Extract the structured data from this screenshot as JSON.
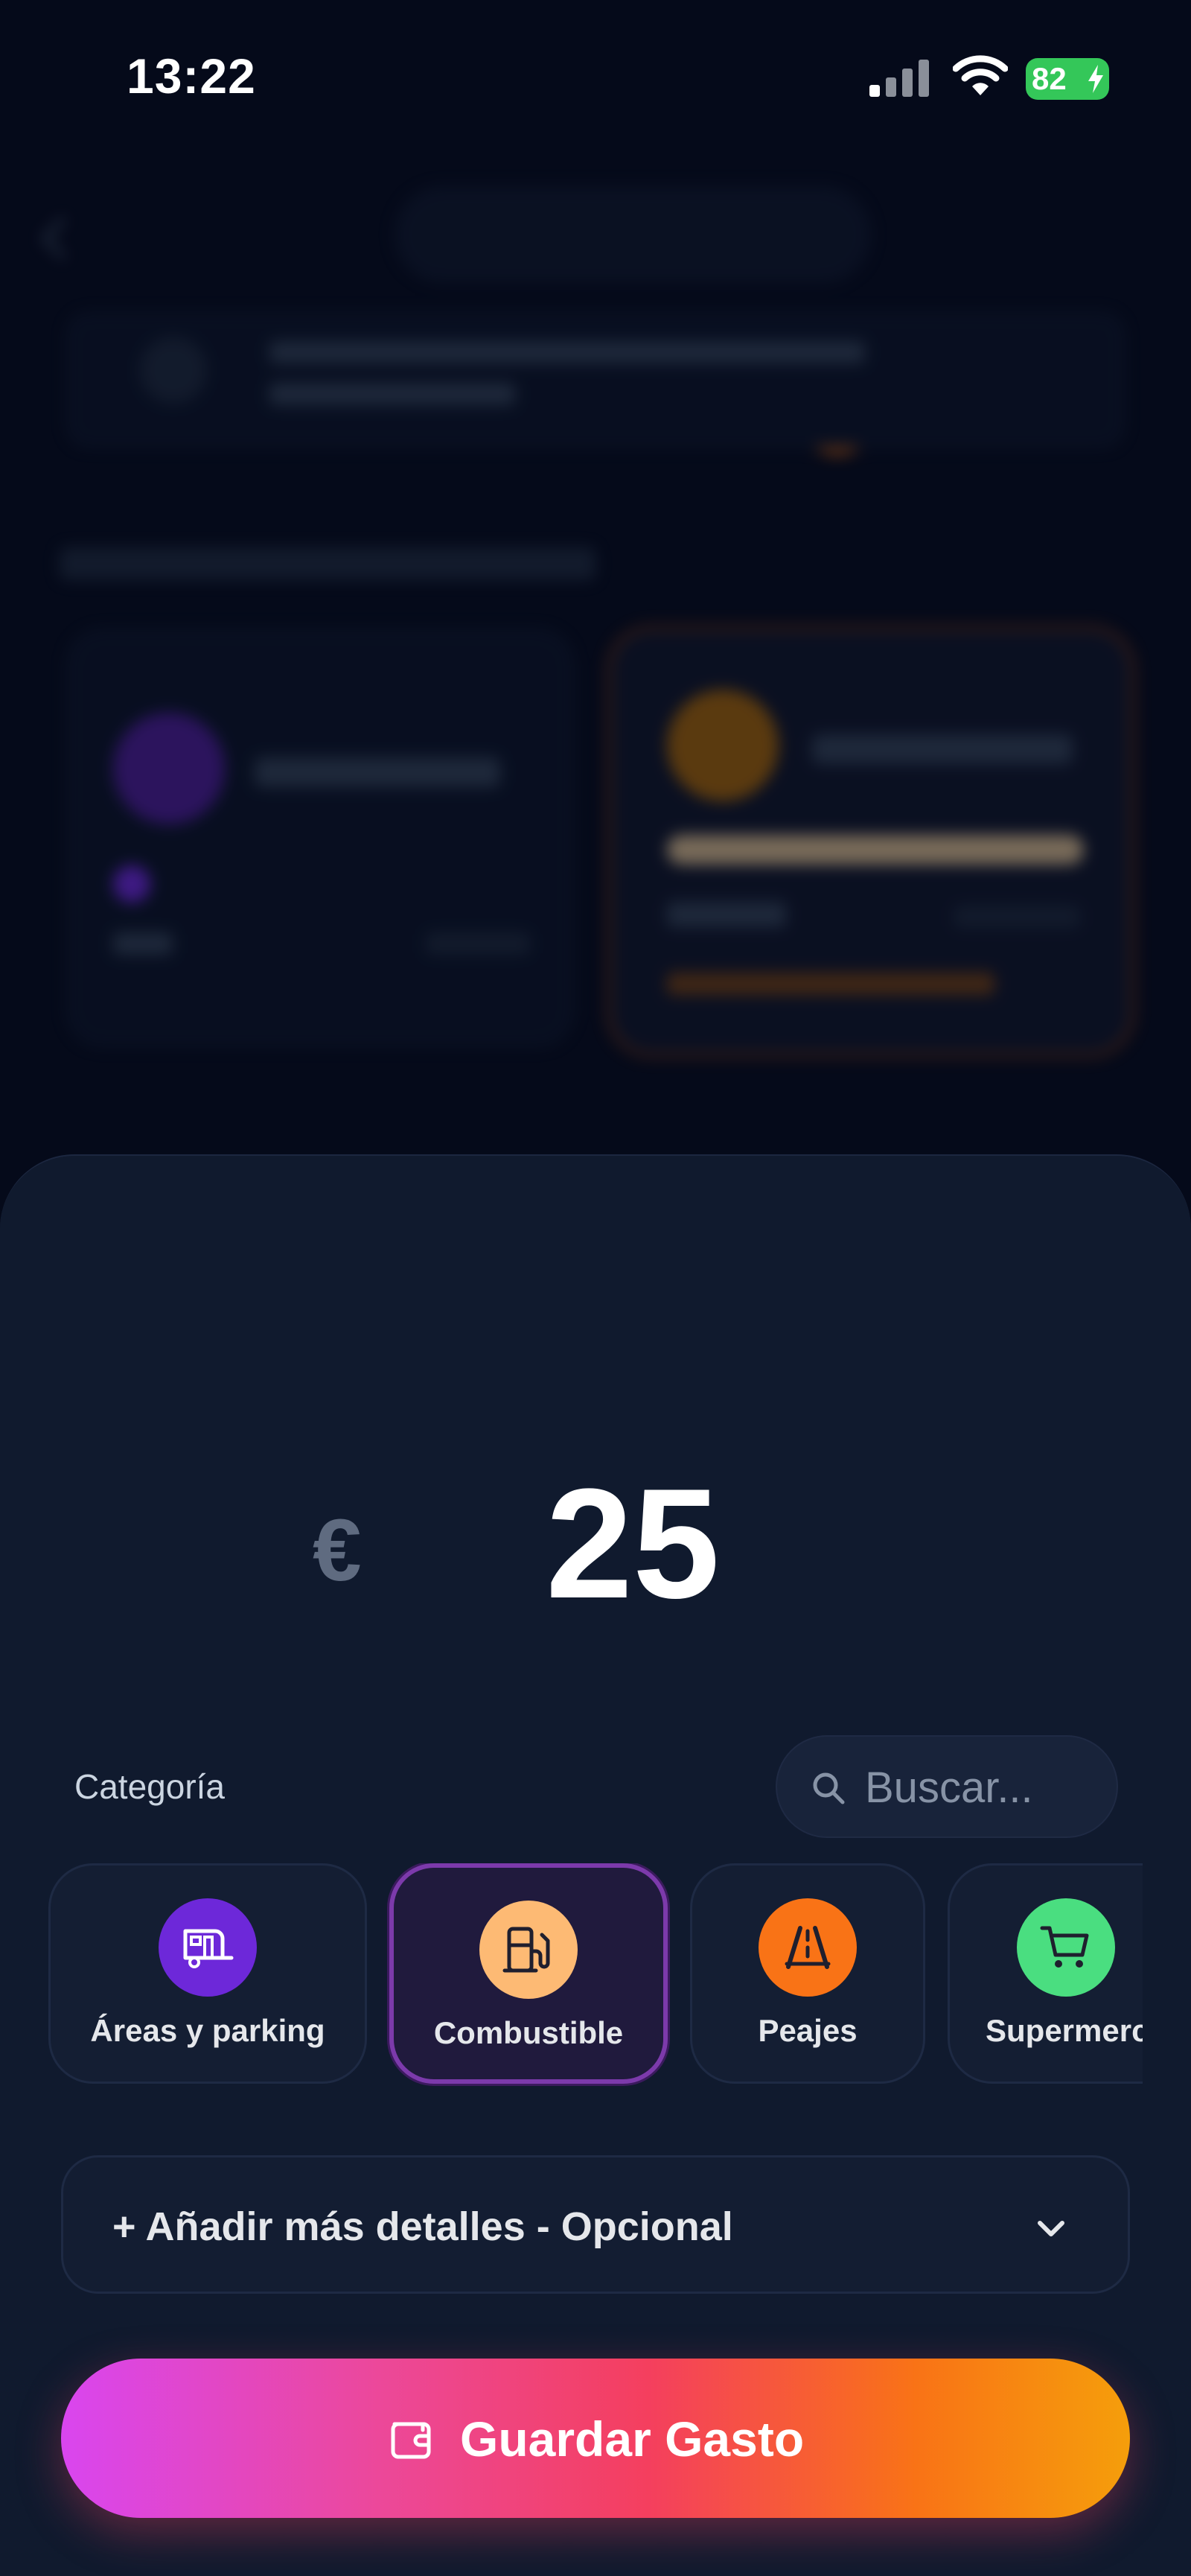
{
  "status_bar": {
    "time": "13:22",
    "battery": "82"
  },
  "expense": {
    "currency_symbol": "€",
    "amount": "25"
  },
  "category_section": {
    "label": "Categoría",
    "search_placeholder": "Buscar..."
  },
  "categories": [
    {
      "label": "Áreas y parking",
      "icon": "camper-van-icon",
      "color": "#6d28d9",
      "selected": false
    },
    {
      "label": "Combustible",
      "icon": "fuel-pump-icon",
      "color": "#fdba74",
      "selected": true
    },
    {
      "label": "Peajes",
      "icon": "road-icon",
      "color": "#f97316",
      "selected": false
    },
    {
      "label": "Supermercado",
      "icon": "shopping-cart-icon",
      "color": "#4ade80",
      "selected": false
    }
  ],
  "details": {
    "label": "+ Añadir más detalles - Opcional"
  },
  "save_button": {
    "label": "Guardar Gasto"
  },
  "colors": {
    "background": "#050a1a",
    "sheet": "#101a2e",
    "selected_border": "#7c3aab",
    "gradient_start": "#d946ef",
    "gradient_end": "#f59e0b"
  }
}
